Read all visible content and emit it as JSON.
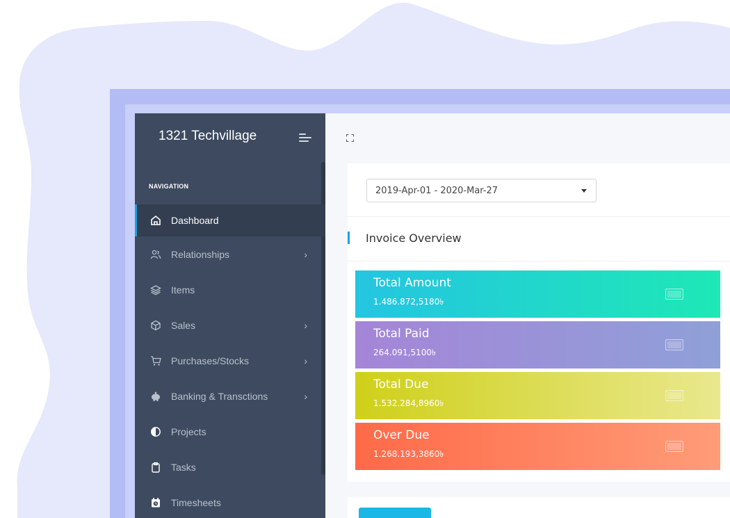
{
  "sidebar": {
    "brand": "1321 Techvillage",
    "nav_heading": "NAVIGATION",
    "items": [
      {
        "label": "Dashboard",
        "icon": "home-icon",
        "active": true,
        "has_submenu": false
      },
      {
        "label": "Relationships",
        "icon": "users-icon",
        "active": false,
        "has_submenu": true
      },
      {
        "label": "Items",
        "icon": "layers-icon",
        "active": false,
        "has_submenu": false
      },
      {
        "label": "Sales",
        "icon": "box-icon",
        "active": false,
        "has_submenu": true
      },
      {
        "label": "Purchases/Stocks",
        "icon": "cart-icon",
        "active": false,
        "has_submenu": true
      },
      {
        "label": "Banking & Transctions",
        "icon": "piggy-bank-icon",
        "active": false,
        "has_submenu": true
      },
      {
        "label": "Projects",
        "icon": "half-circle-icon",
        "active": false,
        "has_submenu": false
      },
      {
        "label": "Tasks",
        "icon": "clipboard-icon",
        "active": false,
        "has_submenu": false
      },
      {
        "label": "Timesheets",
        "icon": "calendar-clock-icon",
        "active": false,
        "has_submenu": false
      }
    ],
    "chevron": "›"
  },
  "main": {
    "date_range": "2019-Apr-01 - 2020-Mar-27",
    "section_title": "Invoice Overview",
    "cards": [
      {
        "label": "Total Amount",
        "value": "1.486.872,5180৳"
      },
      {
        "label": "Total Paid",
        "value": "264.091,5100৳"
      },
      {
        "label": "Total Due",
        "value": "1.532.284,8960৳"
      },
      {
        "label": "Over Due",
        "value": "1.268.193,3860৳"
      }
    ]
  },
  "colors": {
    "sidebar_bg": "#3d4a5f",
    "accent": "#1da1e2",
    "total_amount": "#24c5e1",
    "total_paid": "#a585d8",
    "total_due": "#cfd01a",
    "over_due": "#ff6a48"
  }
}
